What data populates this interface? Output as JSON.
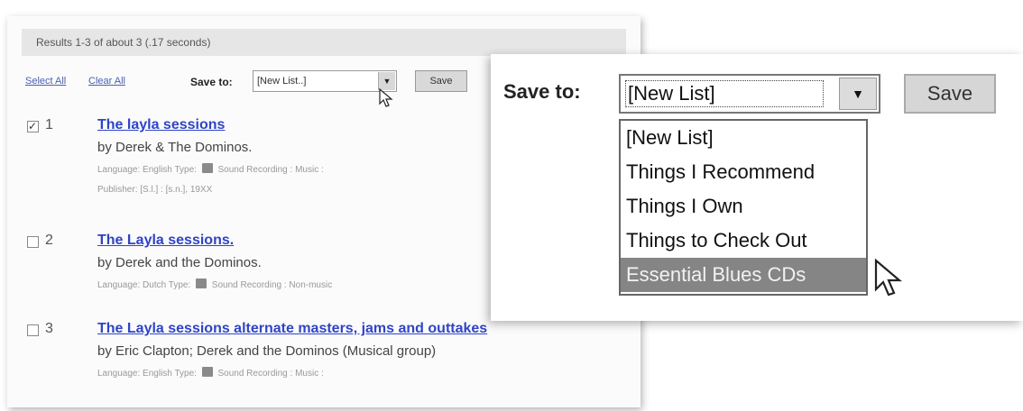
{
  "results_summary": "Results 1-3 of about 3 (.17 seconds)",
  "toolbar": {
    "select_all": "Select All",
    "clear_all": "Clear All",
    "save_to_label": "Save to:",
    "select_value": "[New List..]",
    "save_button": "Save"
  },
  "results": [
    {
      "number": "1",
      "checked": true,
      "title": "The layla sessions",
      "author": "by Derek & The Dominos.",
      "meta": "Language: English  Type:",
      "format": "Sound Recording : Music :",
      "publisher": "Publisher: [S.l.] : [s.n.], 19XX"
    },
    {
      "number": "2",
      "checked": false,
      "title": "The Layla sessions.",
      "author": "by Derek and the Dominos.",
      "meta": "Language: Dutch  Type:",
      "format": "Sound Recording : Non-music"
    },
    {
      "number": "3",
      "checked": false,
      "title": "The Layla sessions alternate masters, jams and outtakes",
      "author": "by Eric Clapton; Derek and the Dominos (Musical group)",
      "meta": "Language: English  Type:",
      "format": "Sound Recording : Music :"
    }
  ],
  "popout": {
    "save_to_label": "Save to:",
    "select_value": "[New List]",
    "save_button": "Save",
    "options": [
      "[New List]",
      "Things I Recommend",
      "Things I Own",
      "Things to Check Out",
      "Essential Blues CDs"
    ],
    "highlighted_option": "Essential Blues CDs"
  },
  "colors": {
    "link": "#2f44c8",
    "highlight": "#858585"
  }
}
